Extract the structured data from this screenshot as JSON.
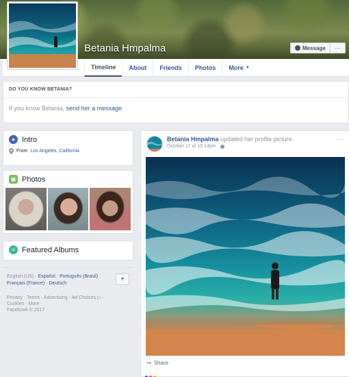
{
  "profile": {
    "name": "Betania Hmpalma",
    "message_label": "Message",
    "more_label": "···"
  },
  "nav": {
    "tabs": [
      {
        "label": "Timeline"
      },
      {
        "label": "About"
      },
      {
        "label": "Friends"
      },
      {
        "label": "Photos"
      },
      {
        "label": "More"
      }
    ]
  },
  "know_box": {
    "title": "DO YOU KNOW BETANIA?",
    "text_before": "If you know Betania,",
    "link": "send her a message",
    "text_after": "."
  },
  "intro": {
    "title": "Intro",
    "from_prefix": "From",
    "location": "Los Angeles, California"
  },
  "photos": {
    "title": "Photos"
  },
  "featured_albums": {
    "title": "Featured Albums"
  },
  "languages": {
    "current": "English (US)",
    "options": [
      "Español",
      "Português (Brasil)",
      "Français (France)",
      "Deutsch"
    ],
    "add_label": "+"
  },
  "footer": {
    "links": [
      "Privacy",
      "Terms",
      "Advertising",
      "Ad Choices"
    ],
    "links2": [
      "Cookies",
      "More"
    ],
    "copyright": "Facebook © 2017"
  },
  "post": {
    "author": "Betania Hmpalma",
    "action": "updated her profile picture.",
    "timestamp": "October 17 at 10:14pm",
    "options": "···",
    "share_label": "Share"
  },
  "colors": {
    "link": "#365899",
    "background": "#e9ebee",
    "intro_icon": "#4267b2",
    "photos_icon": "#7ac25b",
    "albums_icon": "#3ab79c"
  }
}
